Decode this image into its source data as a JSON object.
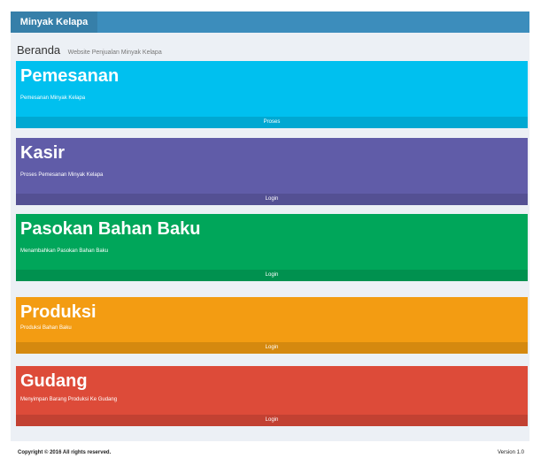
{
  "header": {
    "app_title": "Minyak Kelapa"
  },
  "breadcrumb": {
    "title": "Beranda",
    "subtitle": "Website Penjualan Minyak Kelapa"
  },
  "colors": {
    "header": "#3c8dbc",
    "brand": "#367fa9",
    "pemesanan": "#00c0ef",
    "kasir": "#605ca8",
    "pasokan": "#00a65a",
    "produksi": "#f39c12",
    "gudang": "#dd4b39",
    "content_bg": "#ecf0f5"
  },
  "boxes": [
    {
      "title": "Pemesanan",
      "desc": "Pemesanan Minyak Kelapa",
      "action": "Proses"
    },
    {
      "title": "Kasir",
      "desc": "Proses Pemesanan Minyak Kelapa",
      "action": "Login"
    },
    {
      "title": "Pasokan Bahan Baku",
      "desc": "Menambahkan Pasokan Bahan Baku",
      "action": "Login"
    },
    {
      "title": "Produksi",
      "desc": "Produksi Bahan Baku",
      "action": "Login"
    },
    {
      "title": "Gudang",
      "desc": "Menyimpan Barang Produksi Ke Gudang",
      "action": "Login"
    }
  ],
  "footer": {
    "copyright": "Copyright © 2016 All rights reserved.",
    "version": "Version 1.0"
  }
}
